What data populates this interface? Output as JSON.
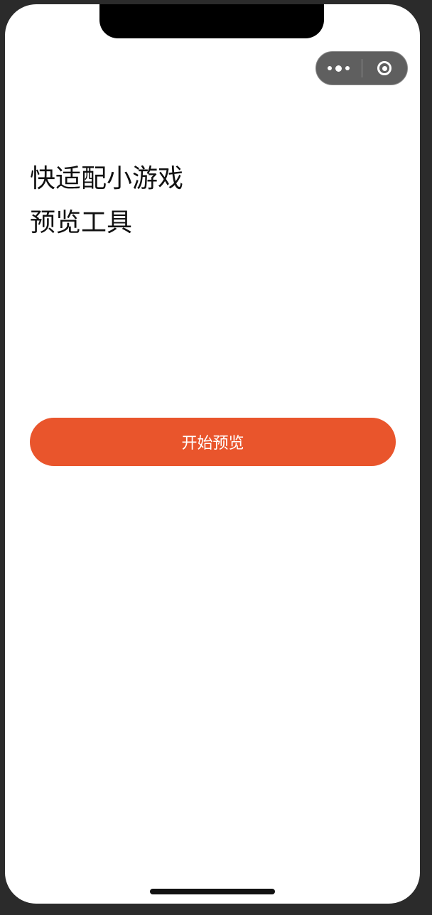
{
  "header": {
    "title_line1": "快适配小游戏",
    "title_line2": "预览工具"
  },
  "main": {
    "start_button_label": "开始预览"
  },
  "capsule": {
    "more_icon": "more-dots-icon",
    "close_icon": "target-circle-icon"
  },
  "colors": {
    "accent": "#e9552c",
    "capsule_bg": "#5f5f5f",
    "text": "#111111"
  }
}
